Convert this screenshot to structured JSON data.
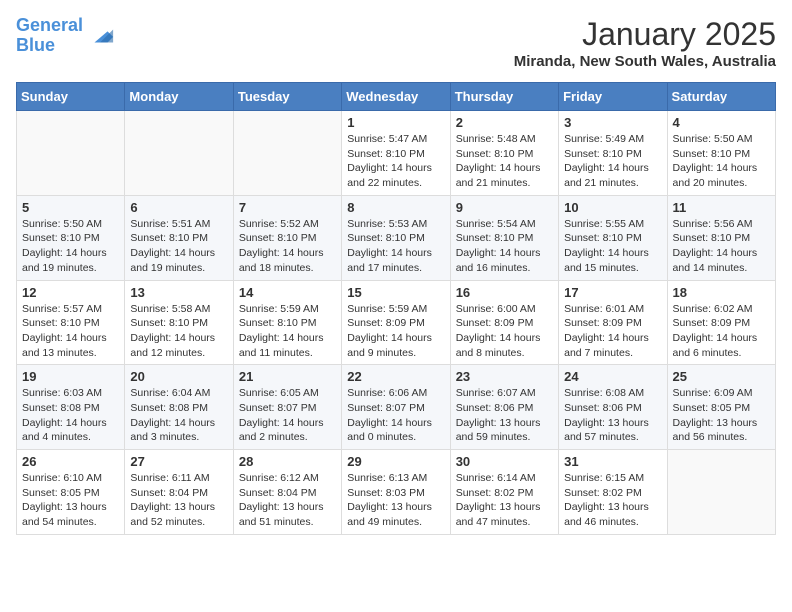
{
  "logo": {
    "line1": "General",
    "line2": "Blue"
  },
  "header": {
    "month": "January 2025",
    "location": "Miranda, New South Wales, Australia"
  },
  "weekdays": [
    "Sunday",
    "Monday",
    "Tuesday",
    "Wednesday",
    "Thursday",
    "Friday",
    "Saturday"
  ],
  "weeks": [
    [
      {
        "day": "",
        "info": ""
      },
      {
        "day": "",
        "info": ""
      },
      {
        "day": "",
        "info": ""
      },
      {
        "day": "1",
        "info": "Sunrise: 5:47 AM\nSunset: 8:10 PM\nDaylight: 14 hours\nand 22 minutes."
      },
      {
        "day": "2",
        "info": "Sunrise: 5:48 AM\nSunset: 8:10 PM\nDaylight: 14 hours\nand 21 minutes."
      },
      {
        "day": "3",
        "info": "Sunrise: 5:49 AM\nSunset: 8:10 PM\nDaylight: 14 hours\nand 21 minutes."
      },
      {
        "day": "4",
        "info": "Sunrise: 5:50 AM\nSunset: 8:10 PM\nDaylight: 14 hours\nand 20 minutes."
      }
    ],
    [
      {
        "day": "5",
        "info": "Sunrise: 5:50 AM\nSunset: 8:10 PM\nDaylight: 14 hours\nand 19 minutes."
      },
      {
        "day": "6",
        "info": "Sunrise: 5:51 AM\nSunset: 8:10 PM\nDaylight: 14 hours\nand 19 minutes."
      },
      {
        "day": "7",
        "info": "Sunrise: 5:52 AM\nSunset: 8:10 PM\nDaylight: 14 hours\nand 18 minutes."
      },
      {
        "day": "8",
        "info": "Sunrise: 5:53 AM\nSunset: 8:10 PM\nDaylight: 14 hours\nand 17 minutes."
      },
      {
        "day": "9",
        "info": "Sunrise: 5:54 AM\nSunset: 8:10 PM\nDaylight: 14 hours\nand 16 minutes."
      },
      {
        "day": "10",
        "info": "Sunrise: 5:55 AM\nSunset: 8:10 PM\nDaylight: 14 hours\nand 15 minutes."
      },
      {
        "day": "11",
        "info": "Sunrise: 5:56 AM\nSunset: 8:10 PM\nDaylight: 14 hours\nand 14 minutes."
      }
    ],
    [
      {
        "day": "12",
        "info": "Sunrise: 5:57 AM\nSunset: 8:10 PM\nDaylight: 14 hours\nand 13 minutes."
      },
      {
        "day": "13",
        "info": "Sunrise: 5:58 AM\nSunset: 8:10 PM\nDaylight: 14 hours\nand 12 minutes."
      },
      {
        "day": "14",
        "info": "Sunrise: 5:59 AM\nSunset: 8:10 PM\nDaylight: 14 hours\nand 11 minutes."
      },
      {
        "day": "15",
        "info": "Sunrise: 5:59 AM\nSunset: 8:09 PM\nDaylight: 14 hours\nand 9 minutes."
      },
      {
        "day": "16",
        "info": "Sunrise: 6:00 AM\nSunset: 8:09 PM\nDaylight: 14 hours\nand 8 minutes."
      },
      {
        "day": "17",
        "info": "Sunrise: 6:01 AM\nSunset: 8:09 PM\nDaylight: 14 hours\nand 7 minutes."
      },
      {
        "day": "18",
        "info": "Sunrise: 6:02 AM\nSunset: 8:09 PM\nDaylight: 14 hours\nand 6 minutes."
      }
    ],
    [
      {
        "day": "19",
        "info": "Sunrise: 6:03 AM\nSunset: 8:08 PM\nDaylight: 14 hours\nand 4 minutes."
      },
      {
        "day": "20",
        "info": "Sunrise: 6:04 AM\nSunset: 8:08 PM\nDaylight: 14 hours\nand 3 minutes."
      },
      {
        "day": "21",
        "info": "Sunrise: 6:05 AM\nSunset: 8:07 PM\nDaylight: 14 hours\nand 2 minutes."
      },
      {
        "day": "22",
        "info": "Sunrise: 6:06 AM\nSunset: 8:07 PM\nDaylight: 14 hours\nand 0 minutes."
      },
      {
        "day": "23",
        "info": "Sunrise: 6:07 AM\nSunset: 8:06 PM\nDaylight: 13 hours\nand 59 minutes."
      },
      {
        "day": "24",
        "info": "Sunrise: 6:08 AM\nSunset: 8:06 PM\nDaylight: 13 hours\nand 57 minutes."
      },
      {
        "day": "25",
        "info": "Sunrise: 6:09 AM\nSunset: 8:05 PM\nDaylight: 13 hours\nand 56 minutes."
      }
    ],
    [
      {
        "day": "26",
        "info": "Sunrise: 6:10 AM\nSunset: 8:05 PM\nDaylight: 13 hours\nand 54 minutes."
      },
      {
        "day": "27",
        "info": "Sunrise: 6:11 AM\nSunset: 8:04 PM\nDaylight: 13 hours\nand 52 minutes."
      },
      {
        "day": "28",
        "info": "Sunrise: 6:12 AM\nSunset: 8:04 PM\nDaylight: 13 hours\nand 51 minutes."
      },
      {
        "day": "29",
        "info": "Sunrise: 6:13 AM\nSunset: 8:03 PM\nDaylight: 13 hours\nand 49 minutes."
      },
      {
        "day": "30",
        "info": "Sunrise: 6:14 AM\nSunset: 8:02 PM\nDaylight: 13 hours\nand 47 minutes."
      },
      {
        "day": "31",
        "info": "Sunrise: 6:15 AM\nSunset: 8:02 PM\nDaylight: 13 hours\nand 46 minutes."
      },
      {
        "day": "",
        "info": ""
      }
    ]
  ]
}
